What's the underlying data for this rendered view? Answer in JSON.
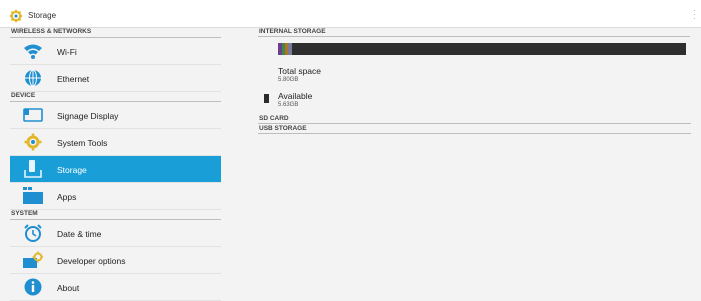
{
  "window": {
    "caption": ""
  },
  "actionbar": {
    "title": "Storage",
    "icon": "gear-icon"
  },
  "sidebar": {
    "sections": [
      {
        "title": "WIRELESS & NETWORKS",
        "items": [
          {
            "label": "Wi-Fi",
            "icon": "wifi-icon"
          },
          {
            "label": "Ethernet",
            "icon": "ethernet-icon"
          }
        ]
      },
      {
        "title": "DEVICE",
        "items": [
          {
            "label": "Signage Display",
            "icon": "display-icon"
          },
          {
            "label": "System Tools",
            "icon": "tools-gear-icon"
          },
          {
            "label": "Storage",
            "icon": "storage-icon",
            "selected": true
          },
          {
            "label": "Apps",
            "icon": "apps-icon"
          }
        ]
      },
      {
        "title": "SYSTEM",
        "items": [
          {
            "label": "Date & time",
            "icon": "clock-icon"
          },
          {
            "label": "Developer options",
            "icon": "developer-icon"
          },
          {
            "label": "About",
            "icon": "info-icon"
          }
        ]
      }
    ]
  },
  "storage": {
    "internal_title": "INTERNAL STORAGE",
    "used_fraction": 0.035,
    "total_label": "Total space",
    "total_value": "5.80GB",
    "available_label": "Available",
    "available_value": "5.63GB",
    "sd_title": "SD CARD",
    "usb_title": "USB STORAGE"
  },
  "colors": {
    "accent": "#1a9ed8",
    "icon_blue": "#1f8fd1",
    "icon_yellow": "#e3b72a"
  }
}
